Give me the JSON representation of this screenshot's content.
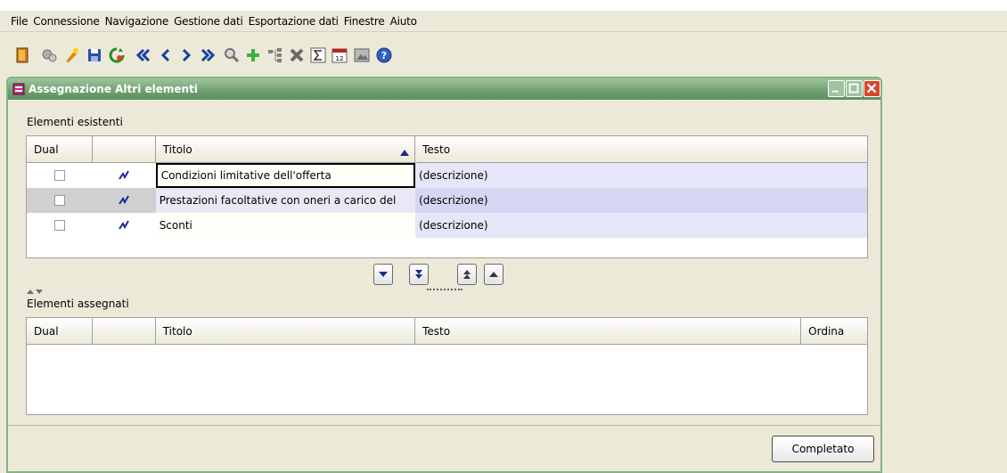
{
  "menu": [
    "File",
    "Connessione",
    "Navigazione",
    "Gestione dati",
    "Esportazione dati",
    "Finestre",
    "Aiuto"
  ],
  "toolbar_icons": [
    "exit-icon",
    "settings-icon",
    "wizard-icon",
    "save-icon",
    "refresh-icon",
    "first-icon",
    "previous-icon",
    "next-icon",
    "last-icon",
    "search-icon",
    "add-icon",
    "tree-icon",
    "delete-icon",
    "sum-icon",
    "calendar-icon",
    "image-icon",
    "help-icon"
  ],
  "window": {
    "title": "Assegnazione Altri elementi"
  },
  "existing": {
    "label": "Elementi esistenti",
    "columns": [
      "Dual",
      "",
      "Titolo",
      "Testo"
    ],
    "rows": [
      {
        "titolo": "Condizioni limitative dell'offerta",
        "testo": "(descrizione)"
      },
      {
        "titolo": "Prestazioni facoltative con oneri a carico del",
        "testo": "(descrizione)"
      },
      {
        "titolo": "Sconti",
        "testo": "(descrizione)"
      }
    ]
  },
  "assigned": {
    "label": "Elementi assegnati",
    "columns": [
      "Dual",
      "",
      "Titolo",
      "Testo",
      "Ordina"
    ]
  },
  "buttons": {
    "completed": "Completato"
  },
  "colors": {
    "title_bar": "#6f9f6f",
    "row_bg": "#e6e6fa",
    "row_selected": "#d6d6f2",
    "window_bg": "#ece9d8"
  }
}
